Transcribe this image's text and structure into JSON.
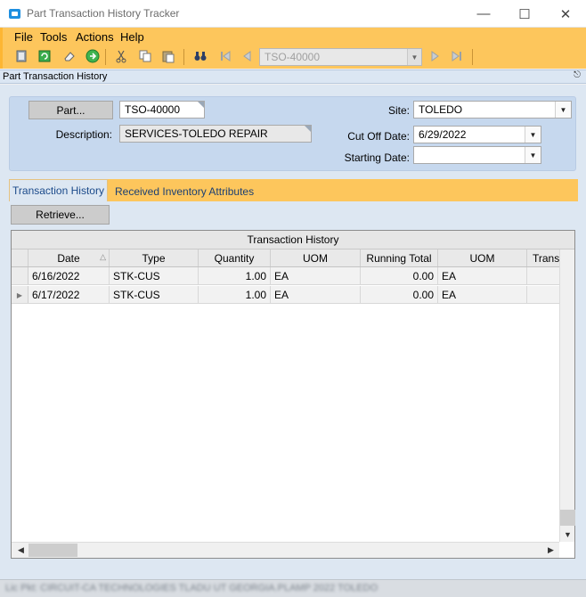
{
  "window": {
    "title": "Part Transaction History Tracker"
  },
  "menu": [
    "File",
    "Tools",
    "Actions",
    "Help"
  ],
  "toolbar": {
    "icons": [
      "clipboard-icon",
      "refresh-icon",
      "eraser-icon",
      "go-icon",
      "cut-icon",
      "copy-icon",
      "paste-icon",
      "binoculars-icon",
      "first-record-icon",
      "previous-record-icon",
      "next-record-icon",
      "last-record-icon"
    ],
    "part_selector_value": "TSO-40000"
  },
  "panel": {
    "title": "Part Transaction History"
  },
  "form": {
    "part_button": "Part...",
    "part_value": "TSO-40000",
    "description_label": "Description:",
    "description_value": "SERVICES-TOLEDO REPAIR",
    "site_label": "Site:",
    "site_value": "TOLEDO",
    "cutoff_label": "Cut Off Date:",
    "cutoff_value": "6/29/2022",
    "starting_label": "Starting Date:",
    "starting_value": ""
  },
  "tabs": [
    {
      "label": "Transaction History",
      "active": true
    },
    {
      "label": "Received Inventory Attributes",
      "active": false
    }
  ],
  "retrieve_button": "Retrieve...",
  "grid": {
    "caption": "Transaction History",
    "columns": [
      "Date",
      "Type",
      "Quantity",
      "UOM",
      "Running Total",
      "UOM",
      "Trans"
    ],
    "sort_column": "Date",
    "rows": [
      [
        "6/16/2022",
        "STK-CUS",
        "1.00",
        "EA",
        "0.00",
        "EA",
        ""
      ],
      [
        "6/17/2022",
        "STK-CUS",
        "1.00",
        "EA",
        "0.00",
        "EA",
        ""
      ]
    ]
  },
  "status": {
    "text": "Lic Pkt: CIRCUIT-CA TECHNOLOGIES    TLADU  UT GEORGIA.PLAMP  2022  TOLEDO"
  }
}
